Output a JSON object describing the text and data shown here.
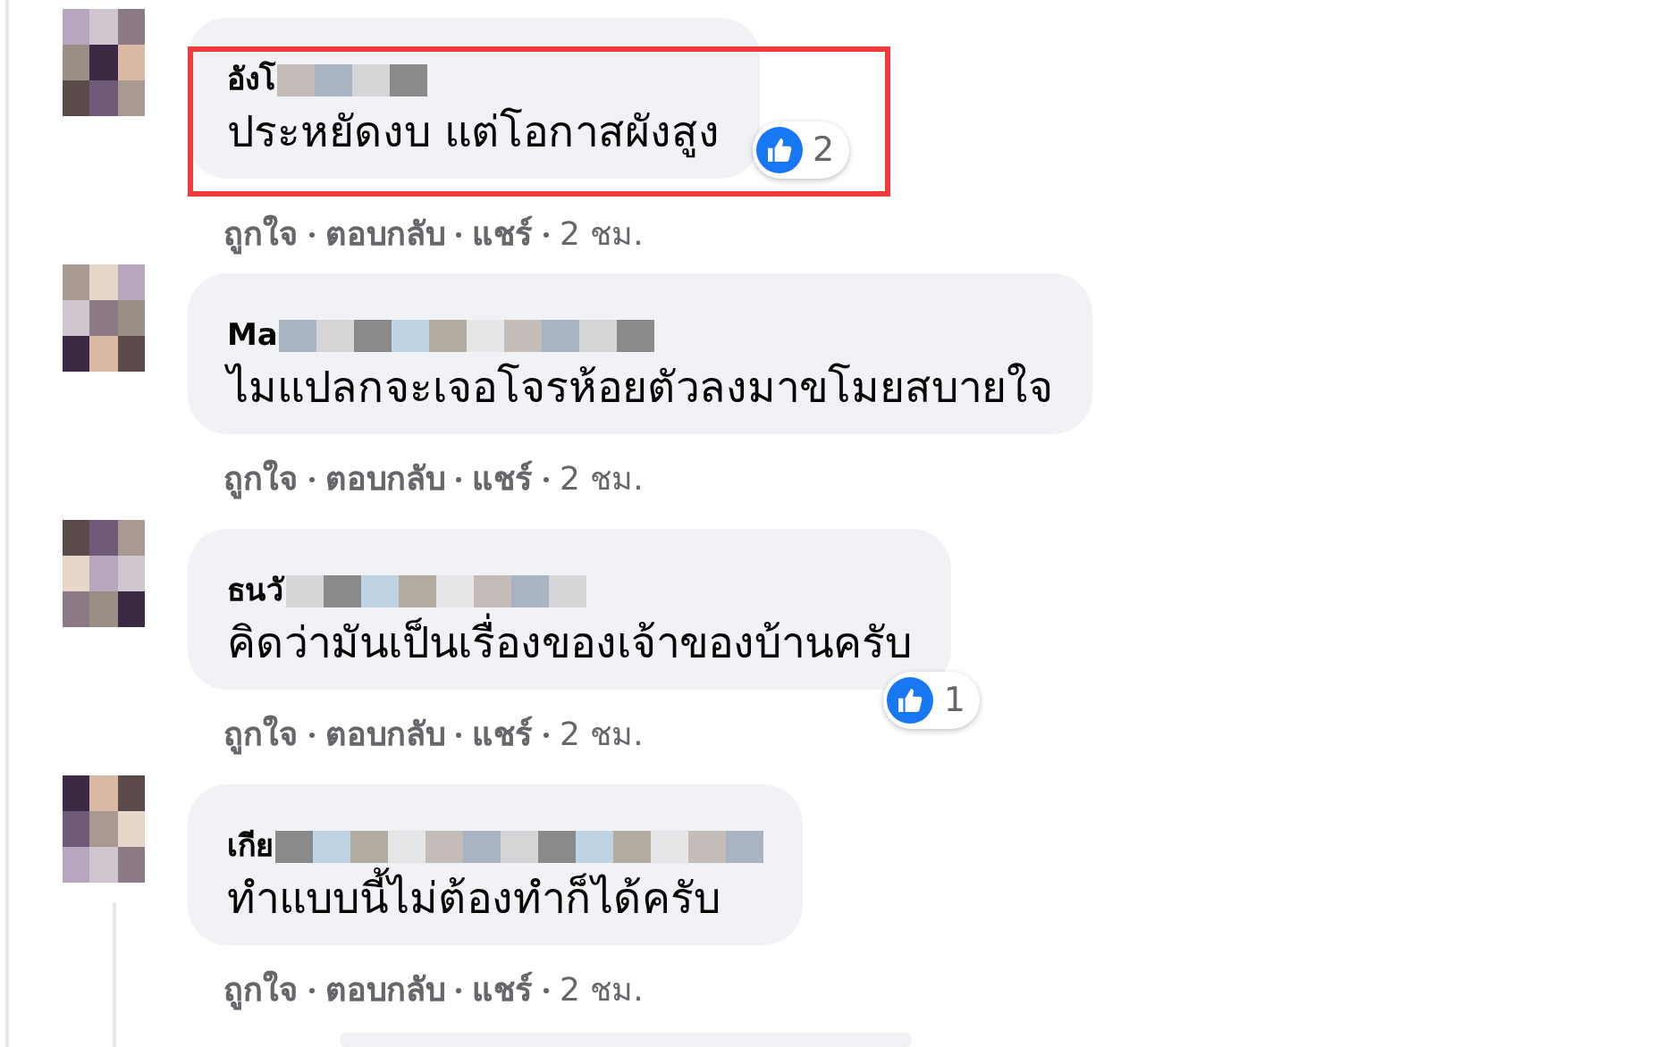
{
  "comments": [
    {
      "author": "อังโ",
      "text": "ประหยัดงบ แต่โอกาสผังสูง",
      "highlighted": true,
      "reaction_count": "2",
      "actions": [
        "ถูกใจ",
        "ตอบกลับ",
        "แชร์"
      ],
      "time": "2 ชม."
    },
    {
      "author": "Ma",
      "text": "ไมแปลกจะเจอโจรห้อยตัวลงมาขโมยสบายใจ",
      "highlighted": false,
      "actions": [
        "ถูกใจ",
        "ตอบกลับ",
        "แชร์"
      ],
      "time": "2 ชม."
    },
    {
      "author": "ธนวั",
      "text": "คิดว่ามันเป็นเรื่องของเจ้าของบ้านครับ",
      "highlighted": false,
      "reaction_count": "1",
      "actions": [
        "ถูกใจ",
        "ตอบกลับ",
        "แชร์"
      ],
      "time": "2 ชม."
    },
    {
      "author": "เกีย",
      "text": "ทำแบบนี้ไม่ต้องทำก็ได้ครับ",
      "highlighted": false,
      "actions": [
        "ถูกใจ",
        "ตอบกลับ",
        "แชร์"
      ],
      "time": "2 ชม."
    }
  ]
}
